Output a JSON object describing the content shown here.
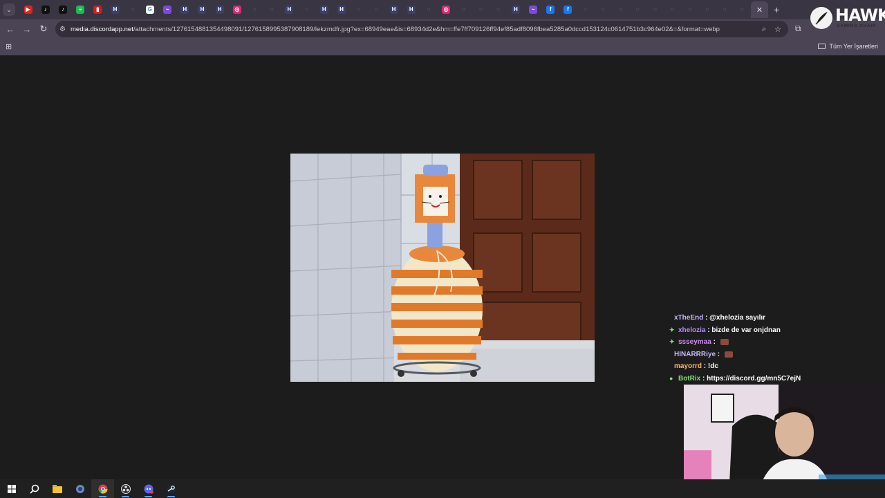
{
  "browser": {
    "tab_count_visible": 43,
    "tab_menu_icon": "chevron-down-icon",
    "active_tab_close": "✕",
    "new_tab": "+",
    "url_host": "media.discordapp.net",
    "url_rest": "/attachments/1276154881354498091/1276158995387908189/lekzmdfr.jpg?ex=68949eae&is=68934d2e&hm=ffe7ff709126ff94ef85adf8096fbea5285a0dccd153124c0614751b3c964e02&=&format=webp",
    "bookmark_folder": "Tüm Yer İşaretleri"
  },
  "overlay": {
    "logo_text": "HAWK",
    "logo_subtext": "GAMING CHAIR"
  },
  "chat": [
    {
      "user": "xTheEnd",
      "user_color": "#c9b6ff",
      "badge": "",
      "message": "@xhelozia sayılır",
      "emote": false
    },
    {
      "user": "xhelozia",
      "user_color": "#b48cff",
      "badge": "✦",
      "badge_color": "#7fe07a",
      "message": "bizde de var onjdnan",
      "emote": false
    },
    {
      "user": "ssseymaa",
      "user_color": "#d08cf0",
      "badge": "✦",
      "badge_color": "#7fe07a",
      "message": "",
      "emote": true
    },
    {
      "user": "HINARRRiye",
      "user_color": "#c0b8ff",
      "badge": "",
      "message": "",
      "emote": true
    },
    {
      "user": "mayorrd",
      "user_color": "#ffb46b",
      "badge": "",
      "message": "!dc",
      "emote": false
    },
    {
      "user": "BotRix",
      "user_color": "#7ee07a",
      "badge": "●",
      "badge_color": "#7ee07a",
      "message": "https://discord.gg/mn5C7ejN",
      "emote": false
    }
  ],
  "taskbar": {
    "items": [
      "windows-start",
      "search",
      "file-explorer",
      "app-blue",
      "chrome",
      "obs",
      "discord",
      "steam"
    ]
  },
  "colors": {
    "tabstrip": "#3a3542",
    "toolbar": "#4a4454",
    "page_bg": "#1c1c1c",
    "taskbar": "#202020"
  }
}
